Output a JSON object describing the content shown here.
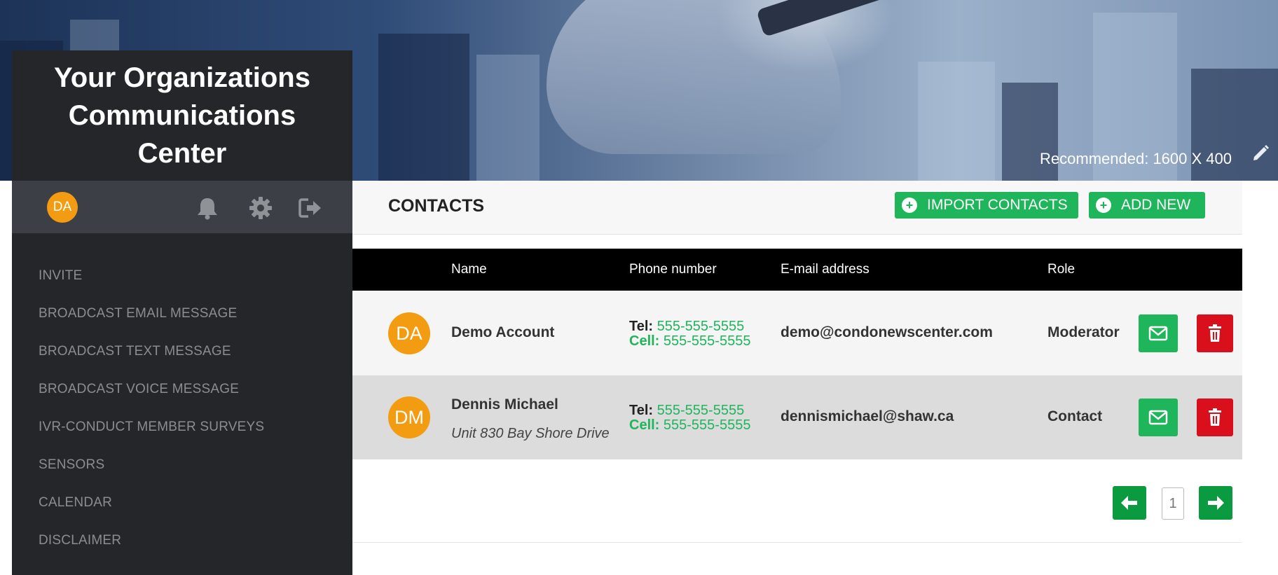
{
  "banner": {
    "recommended": "Recommended: 1600 X 400"
  },
  "sidebar": {
    "brand": "Your Organizations Communications Center",
    "user_initials": "DA",
    "menu": [
      {
        "label": "INVITE"
      },
      {
        "label": "BROADCAST EMAIL MESSAGE"
      },
      {
        "label": "BROADCAST TEXT MESSAGE"
      },
      {
        "label": "BROADCAST VOICE MESSAGE"
      },
      {
        "label": "IVR-CONDUCT MEMBER SURVEYS"
      },
      {
        "label": "SENSORS"
      },
      {
        "label": "CALENDAR"
      },
      {
        "label": "DISCLAIMER"
      }
    ]
  },
  "toolbar": {
    "title": "CONTACTS",
    "import_label": "IMPORT CONTACTS",
    "add_label": "ADD NEW"
  },
  "table": {
    "columns": {
      "name": "Name",
      "phone": "Phone number",
      "email": "E-mail address",
      "role": "Role"
    },
    "phone_labels": {
      "tel": "Tel:",
      "cell": "Cell:"
    },
    "rows": [
      {
        "initials": "DA",
        "name": "Demo Account",
        "address": "",
        "tel": "555-555-5555",
        "cell": "555-555-5555",
        "email": "demo@condonewscenter.com",
        "role": "Moderator"
      },
      {
        "initials": "DM",
        "name": "Dennis Michael",
        "address": "Unit 830 Bay Shore Drive",
        "tel": "555-555-5555",
        "cell": "555-555-5555",
        "email": "dennismichael@shaw.ca",
        "role": "Contact"
      }
    ]
  },
  "pagination": {
    "current": "1"
  },
  "icons": {
    "notifications": "bell-icon",
    "settings": "gear-icon",
    "logout": "sign-out-icon",
    "edit_banner": "pencil-icon",
    "mail": "envelope-icon",
    "delete": "trash-icon"
  },
  "colors": {
    "accent_green": "#1fb55a",
    "danger_red": "#d9101c",
    "avatar_orange": "#f39c12",
    "sidebar": "#242629"
  }
}
